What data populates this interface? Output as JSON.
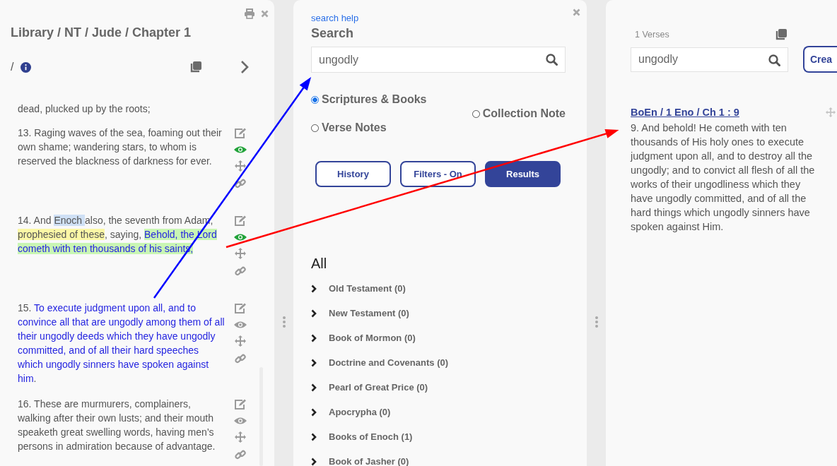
{
  "left_panel": {
    "breadcrumb": "Library / NT / Jude / Chapter 1",
    "path_separator": "/",
    "verses": [
      {
        "kind": "partial",
        "segments": [
          {
            "kind": "plain",
            "text": "dead, plucked up by the roots;"
          }
        ]
      },
      {
        "kind": "full",
        "eye_active": true,
        "segments": [
          {
            "kind": "plain",
            "text": "13. Raging waves of the sea, foaming out their own shame; wandering stars, to whom is reserved the blackness of darkness for ever."
          }
        ]
      },
      {
        "kind": "full",
        "eye_active": true,
        "segments": [
          {
            "kind": "plain",
            "text": "14. And "
          },
          {
            "kind": "name",
            "text": "Enoch "
          },
          {
            "kind": "plain",
            "text": "also, the seventh from Adam, "
          },
          {
            "kind": "marked",
            "text": "prophesied of these"
          },
          {
            "kind": "plain",
            "text": ", saying, "
          },
          {
            "kind": "quoted",
            "text": "Behold, the Lord cometh with ten thousands of his saints,"
          }
        ]
      },
      {
        "kind": "full",
        "eye_active": false,
        "segments": [
          {
            "kind": "plain",
            "text": "15. "
          },
          {
            "kind": "linked",
            "text": "To execute judgment upon all, and to convince all that are ungodly among them of all their ungodly deeds which they have ungodly committed, and of all their hard speeches which ungodly sinners have spoken against him"
          },
          {
            "kind": "plain",
            "text": "."
          }
        ]
      },
      {
        "kind": "full",
        "eye_active": false,
        "segments": [
          {
            "kind": "plain",
            "text": "16. These are murmurers, complainers, walking after their own lusts; and their mouth speaketh great swelling words, having men’s persons in admiration because of advantage."
          }
        ]
      }
    ]
  },
  "search_panel": {
    "help_link": "search help",
    "title": "Search",
    "query": "ungodly",
    "scopes": [
      {
        "label": "Scriptures & Books",
        "selected": true
      },
      {
        "label": "Collection Note",
        "selected": false
      },
      {
        "label": "Verse Notes",
        "selected": false
      }
    ],
    "buttons": [
      {
        "label": "History",
        "selected": false
      },
      {
        "label": "Filters - On",
        "selected": false
      },
      {
        "label": "Results",
        "selected": true
      }
    ],
    "tree_heading": "All",
    "tree": [
      {
        "label": "Old Testament (0)",
        "expanded": false
      },
      {
        "label": "New Testament (0)",
        "expanded": false
      },
      {
        "label": "Book of Mormon (0)",
        "expanded": false
      },
      {
        "label": "Doctrine and Covenants (0)",
        "expanded": false
      },
      {
        "label": "Pearl of Great Price (0)",
        "expanded": false
      },
      {
        "label": "Apocrypha (0)",
        "expanded": false
      },
      {
        "label": "Books of Enoch (1)",
        "expanded": false
      },
      {
        "label": "Book of Jasher (0)",
        "expanded": false
      }
    ]
  },
  "results_panel": {
    "count": "1 Verses",
    "query": "ungodly",
    "create_button": "Crea",
    "results": [
      {
        "reference": "BoEn / 1 Eno / Ch 1 : 9",
        "text": "9. And behold! He cometh with ten thousands of His holy ones to execute judgment upon all, and to destroy all the ungodly; and to convict all flesh of all the works of their ungodliness which they have ungodly committed, and of all the hard things which ungodly sinners have spoken against Him."
      }
    ]
  },
  "annotation_arrows": [
    {
      "color": "#0000ff"
    },
    {
      "color": "#ff0000"
    }
  ]
}
